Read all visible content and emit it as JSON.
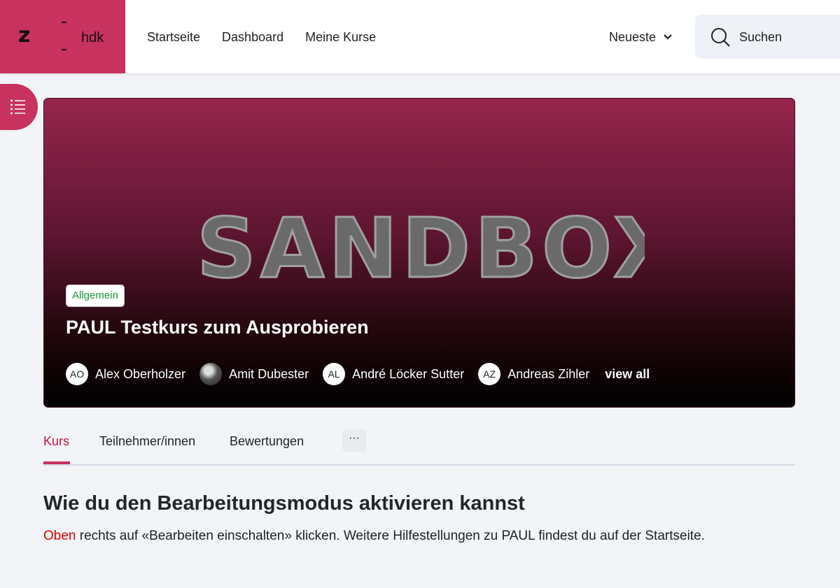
{
  "logo": {
    "letter": "z",
    "name": "hdk",
    "color": "#c8325f"
  },
  "nav": {
    "items": [
      "Startseite",
      "Dashboard",
      "Meine Kurse"
    ]
  },
  "language": {
    "label": "Neueste"
  },
  "search": {
    "label": "Suchen"
  },
  "hero": {
    "banner_text": "SANDBOX",
    "category": "Allgemein",
    "title": "PAUL Testkurs zum Ausprobieren",
    "participants": [
      {
        "initials": "AO",
        "name": "Alex Oberholzer"
      },
      {
        "initials": "",
        "name": "Amit Dubester"
      },
      {
        "initials": "AL",
        "name": "André Löcker Sutter"
      },
      {
        "initials": "AZ",
        "name": "Andreas Zihler"
      }
    ],
    "view_all": "view all"
  },
  "tabs": {
    "items": [
      "Kurs",
      "Teilnehmer/innen",
      "Bewertungen"
    ],
    "more": "···",
    "active": "Kurs"
  },
  "section": {
    "heading": "Wie du den Bearbeitungsmodus aktivieren kannst",
    "highlight": "Oben",
    "text": " rechts auf «Bearbeiten einschalten» klicken. Weitere Hilfestellungen zu PAUL findest du auf der Startseite."
  }
}
